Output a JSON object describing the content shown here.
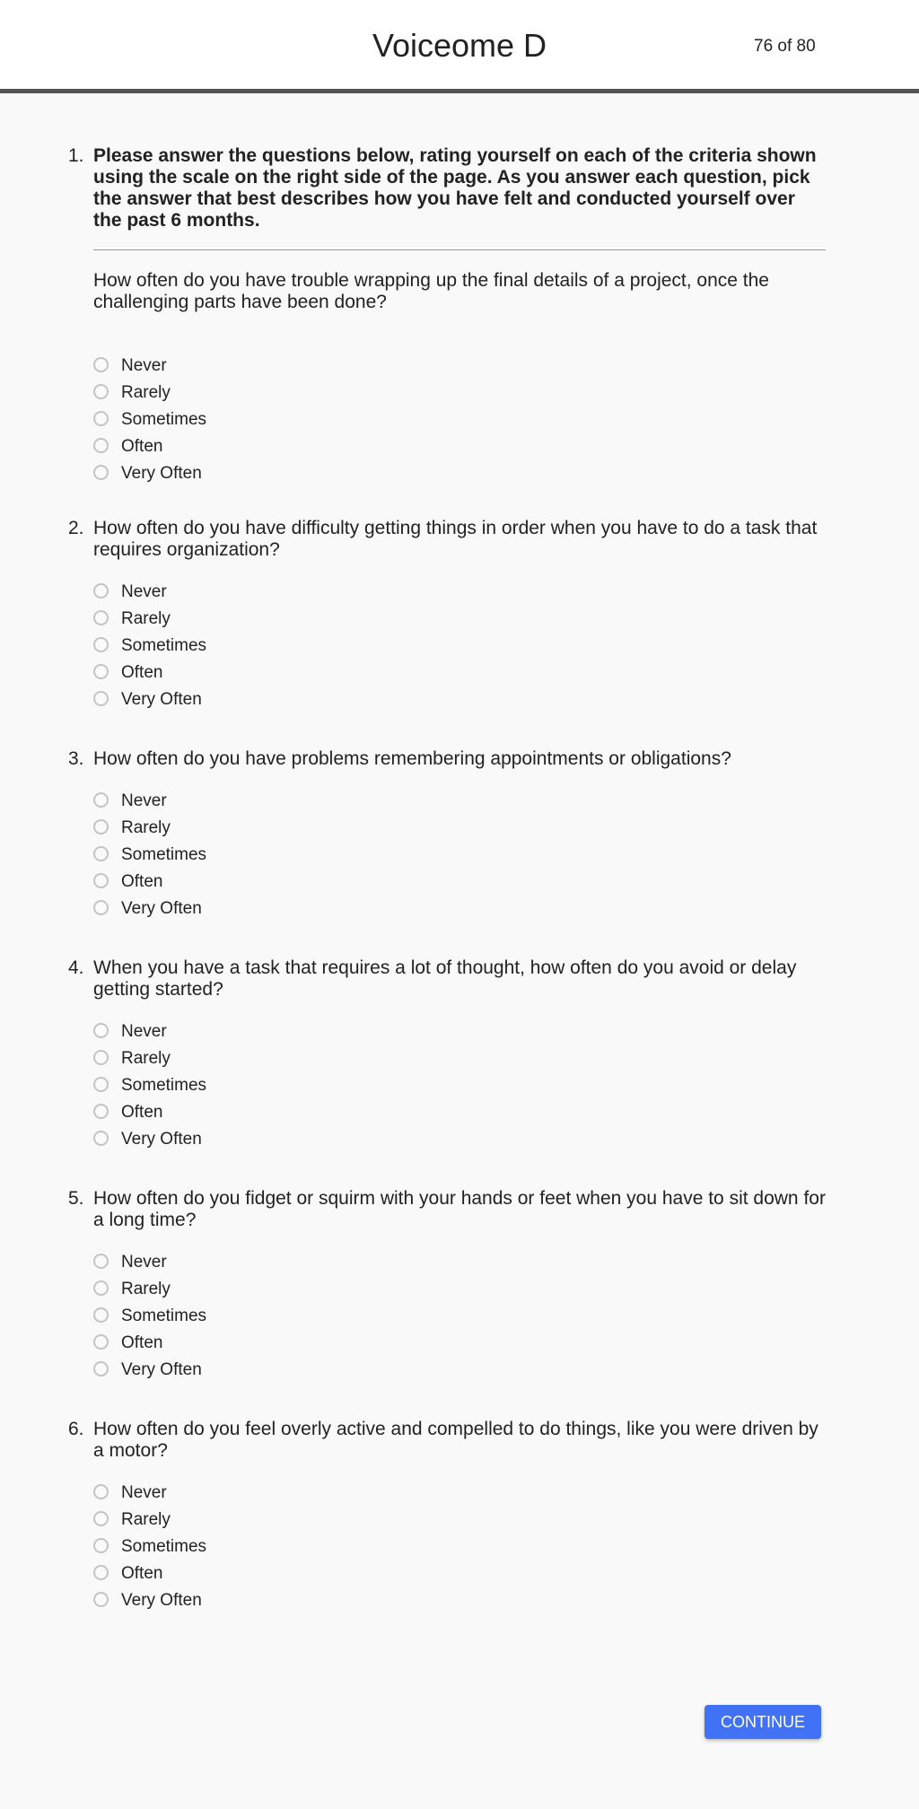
{
  "header": {
    "title": "Voiceome D",
    "progress": "76 of 80"
  },
  "options": [
    "Never",
    "Rarely",
    "Sometimes",
    "Often",
    "Very Often"
  ],
  "questions": [
    {
      "number": "1.",
      "instruction": "Please answer the questions below, rating yourself on each of the criteria shown using the scale on the right side of the page. As you answer each question, pick the answer that best describes how you have felt and conducted yourself over the past 6 months.",
      "text": "How often do you have trouble wrapping up the final details of a project, once the challenging parts have been done?"
    },
    {
      "number": "2.",
      "text": "How often do you have difficulty getting things in order when you have to do a task that requires organization?"
    },
    {
      "number": "3.",
      "text": "How often do you have problems remembering appointments or obligations?"
    },
    {
      "number": "4.",
      "text": "When you have a task that requires a lot of thought, how often do you avoid or delay getting started?"
    },
    {
      "number": "5.",
      "text": "How often do you fidget or squirm with your hands or feet when you have to sit down for a long time?"
    },
    {
      "number": "6.",
      "text": "How often do you feel overly active and compelled to do things, like you were driven by a motor?"
    }
  ],
  "continue_label": "CONTINUE",
  "colors": {
    "accent": "#4171f5",
    "header_border": "#555555",
    "radio_border": "#c4c4c4"
  }
}
